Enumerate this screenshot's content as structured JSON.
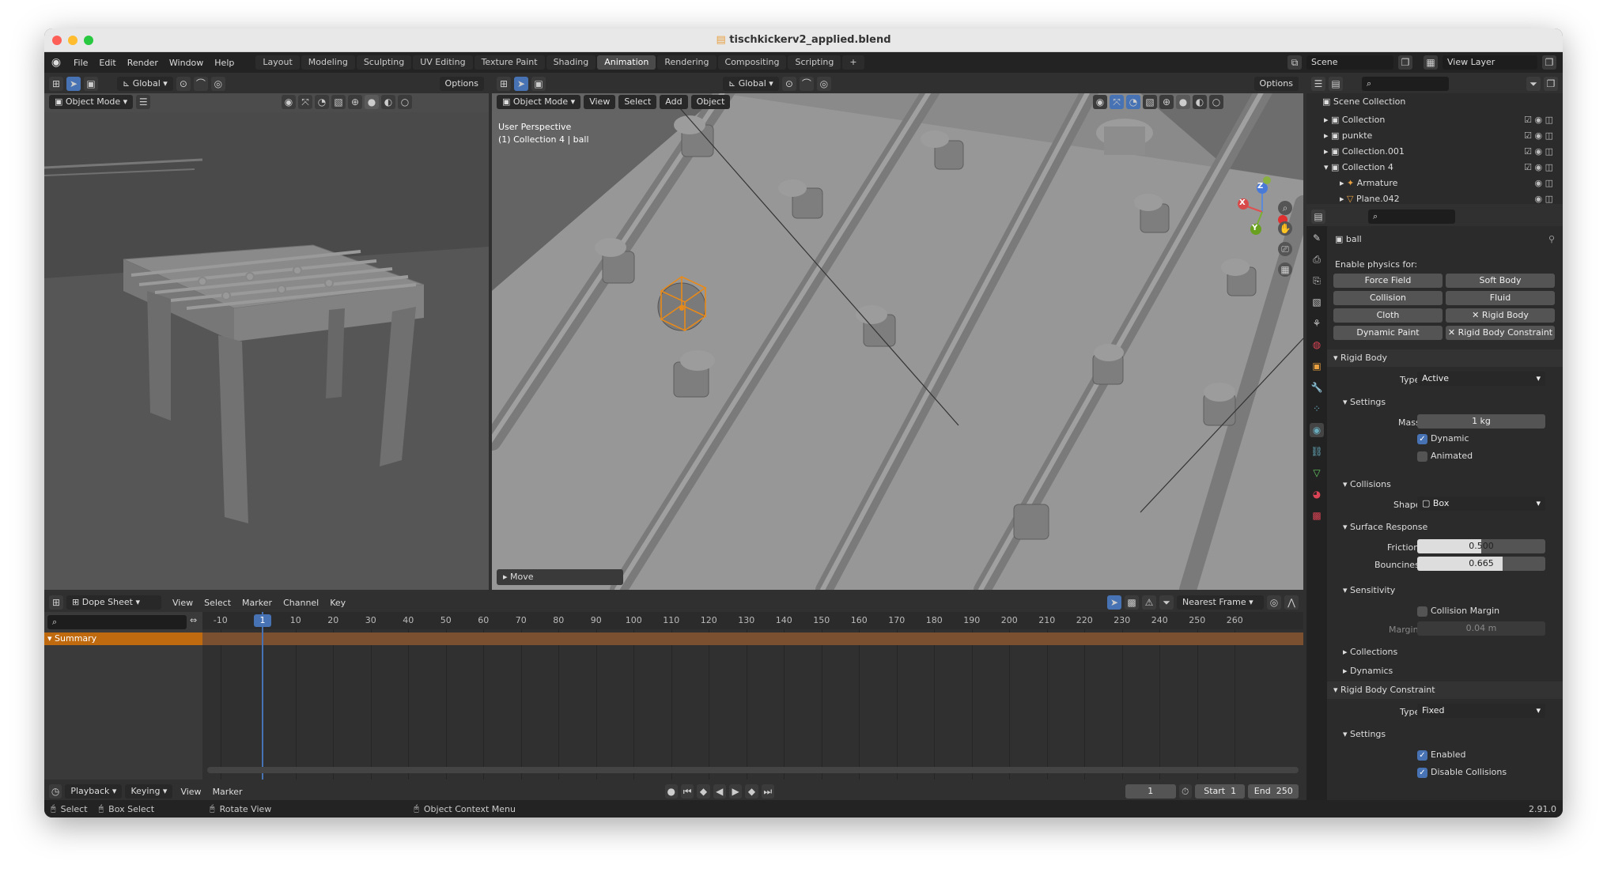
{
  "window": {
    "title": "tischkickerv2_applied.blend"
  },
  "menu": [
    "File",
    "Edit",
    "Render",
    "Window",
    "Help"
  ],
  "workspaces": [
    "Layout",
    "Modeling",
    "Sculpting",
    "UV Editing",
    "Texture Paint",
    "Shading",
    "Animation",
    "Rendering",
    "Compositing",
    "Scripting",
    "+"
  ],
  "active_workspace": "Animation",
  "scene": {
    "name": "Scene",
    "view_layer": "View Layer"
  },
  "left_view": {
    "transform": "Global",
    "options": "Options",
    "mode": "Object Mode"
  },
  "main_view": {
    "transform": "Global",
    "options": "Options",
    "mode": "Object Mode",
    "menus": [
      "View",
      "Select",
      "Add",
      "Object"
    ],
    "overlay_line1": "User Perspective",
    "overlay_line2": "(1) Collection 4 | ball",
    "last_op": "Move",
    "gizmo": {
      "x": "X",
      "y": "Y",
      "z": "Z"
    }
  },
  "outliner": {
    "root": "Scene Collection",
    "items": [
      {
        "label": "Collection"
      },
      {
        "label": "punkte"
      },
      {
        "label": "Collection.001"
      },
      {
        "label": "Collection 4"
      },
      {
        "label": "Armature"
      },
      {
        "label": "Plane.042"
      }
    ]
  },
  "properties": {
    "object": "ball",
    "enable_physics": "Enable physics for:",
    "physics_buttons": [
      [
        "Force Field",
        "Soft Body"
      ],
      [
        "Collision",
        "Fluid"
      ],
      [
        "Cloth",
        "Rigid Body"
      ],
      [
        "Dynamic Paint",
        "Rigid Body Constraint"
      ]
    ],
    "rigid_body": "Rigid Body",
    "type_label": "Type",
    "type_value": "Active",
    "settings": "Settings",
    "mass_label": "Mass",
    "mass_value": "1 kg",
    "dynamic": "Dynamic",
    "animated": "Animated",
    "collisions": "Collisions",
    "shape_label": "Shape",
    "shape_value": "Box",
    "surface_response": "Surface Response",
    "friction_label": "Friction",
    "friction_value": "0.500",
    "friction_fill": 0.5,
    "bounciness_label": "Bounciness",
    "bounciness_value": "0.665",
    "bounciness_fill": 0.665,
    "sensitivity": "Sensitivity",
    "collision_margin": "Collision Margin",
    "margin_label": "Margin",
    "margin_value": "0.04 m",
    "collections": "Collections",
    "dynamics": "Dynamics",
    "rbc": "Rigid Body Constraint",
    "rbc_type_label": "Type",
    "rbc_type_value": "Fixed",
    "rbc_settings": "Settings",
    "enabled": "Enabled",
    "disable_collisions": "Disable Collisions"
  },
  "dopesheet": {
    "editor": "Dope Sheet",
    "menus": [
      "View",
      "Select",
      "Marker",
      "Channel",
      "Key"
    ],
    "snap": "Nearest Frame",
    "summary": "Summary",
    "ticks": [
      "-10",
      "1",
      "10",
      "20",
      "30",
      "40",
      "50",
      "60",
      "70",
      "80",
      "90",
      "100",
      "110",
      "120",
      "130",
      "140",
      "150",
      "160",
      "170",
      "180",
      "190",
      "200",
      "210",
      "220",
      "230",
      "240",
      "250",
      "260"
    ],
    "current_frame": "1"
  },
  "timeline": {
    "menus": [
      "Playback",
      "Keying",
      "View",
      "Marker"
    ],
    "frame": "1",
    "start_label": "Start",
    "start": "1",
    "end_label": "End",
    "end": "250"
  },
  "statusbar": {
    "select": "Select",
    "box_select": "Box Select",
    "rotate": "Rotate View",
    "context": "Object Context Menu",
    "version": "2.91.0"
  },
  "colors": {
    "accent": "#4772b3",
    "selection": "#e88a1a",
    "summary": "#c06a10"
  }
}
